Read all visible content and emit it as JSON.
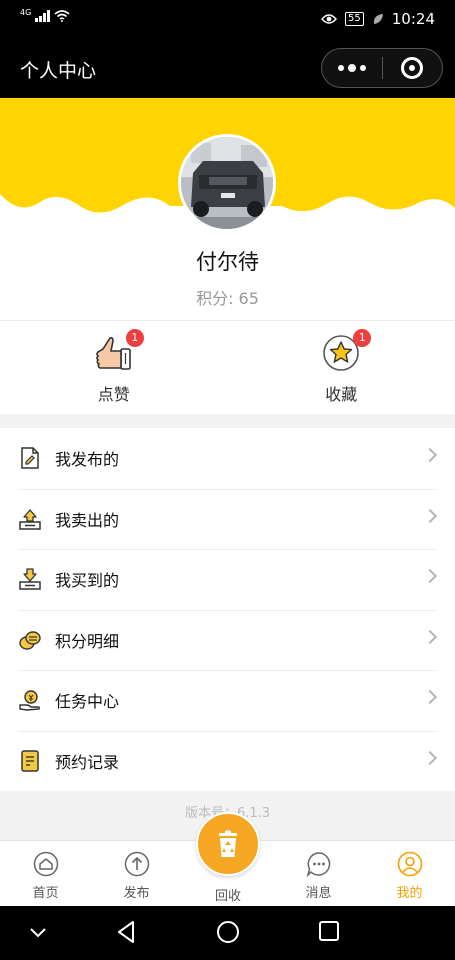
{
  "status_bar": {
    "network": "4G",
    "battery": "55",
    "time": "10:24"
  },
  "nav": {
    "title": "个人中心"
  },
  "profile": {
    "username": "付尔待",
    "score": "积分: 65"
  },
  "stats": [
    {
      "label": "点赞",
      "badge": "1",
      "icon": "thumbs-up-icon"
    },
    {
      "label": "收藏",
      "badge": "1",
      "icon": "star-icon"
    }
  ],
  "menu": [
    {
      "label": "我发布的",
      "icon": "document-edit-icon"
    },
    {
      "label": "我卖出的",
      "icon": "box-upload-icon"
    },
    {
      "label": "我买到的",
      "icon": "box-download-icon"
    },
    {
      "label": "积分明细",
      "icon": "coins-icon"
    },
    {
      "label": "任务中心",
      "icon": "hand-coin-icon"
    },
    {
      "label": "预约记录",
      "icon": "notepad-icon"
    }
  ],
  "version": "版本号：6.1.3",
  "tabs": [
    {
      "label": "首页",
      "icon": "home-icon"
    },
    {
      "label": "发布",
      "icon": "upload-icon"
    },
    {
      "label": "回收",
      "icon": "recycle-bin-icon"
    },
    {
      "label": "消息",
      "icon": "message-icon"
    },
    {
      "label": "我的",
      "icon": "user-icon"
    }
  ],
  "colors": {
    "accent": "#f5a623",
    "header_yellow": "#ffd400",
    "badge": "#ee3e3e",
    "active_tab": "#f5a100"
  }
}
